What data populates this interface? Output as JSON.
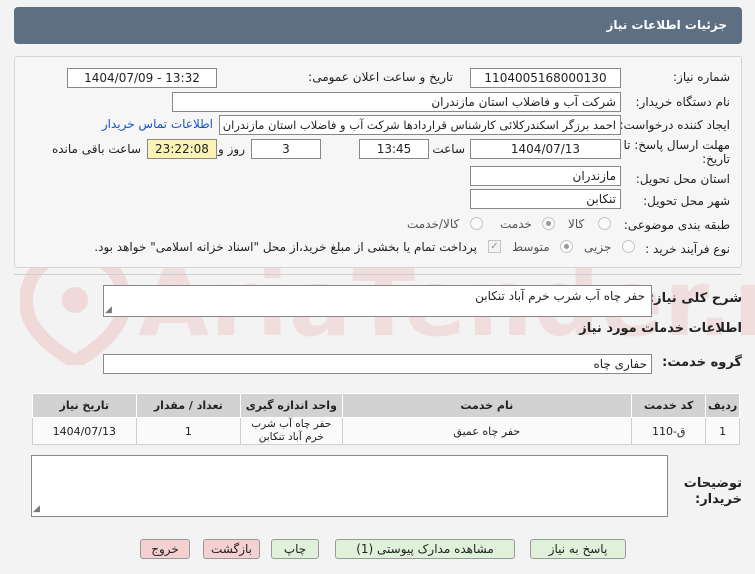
{
  "header": {
    "title": "جزئیات اطلاعات نیاز"
  },
  "fields": {
    "need_number_label": "شماره نیاز:",
    "need_number": "1104005168000130",
    "announce_label": "تاریخ و ساعت اعلان عمومی:",
    "announce_value": "1404/07/09 - 13:32",
    "buyer_org_label": "نام دستگاه خریدار:",
    "buyer_org": "شرکت آب و فاضلاب استان مازندران",
    "requester_label": "ایجاد کننده درخواست:",
    "requester": "احمد برزگر اسکندرکلائی کارشناس قراردادها شرکت آب و فاضلاب استان مازندران",
    "contact_link": "اطلاعات تماس خریدار",
    "deadline_label": "مهلت ارسال پاسخ: تا تاریخ:",
    "deadline_date": "1404/07/13",
    "time_label": "ساعت",
    "deadline_time": "13:45",
    "days_value": "3",
    "days_label": "روز و",
    "remaining_time": "23:22:08",
    "remaining_label": "ساعت باقی مانده",
    "province_label": "استان محل تحویل:",
    "province": "مازندران",
    "city_label": "شهر محل تحویل:",
    "city": "تنکابن",
    "category_label": "طبقه بندی موضوعی:",
    "category_options": [
      "کالا",
      "خدمت",
      "کالا/خدمت"
    ],
    "process_label": "نوع فرآیند خرید :",
    "process_options": [
      "جزیی",
      "متوسط"
    ],
    "payment_note": "پرداخت تمام یا بخشی از مبلغ خرید،از محل \"اسناد خزانه اسلامی\" خواهد بود."
  },
  "description": {
    "label": "شرح کلی نیاز:",
    "value": "حفر چاه آب شرب خرم آباد تنکابن"
  },
  "services": {
    "section_title": "اطلاعات خدمات مورد نیاز",
    "group_label": "گروه خدمت:",
    "group_value": "حفاری چاه",
    "columns": [
      "ردیف",
      "کد خدمت",
      "نام خدمت",
      "واحد اندازه گیری",
      "تعداد / مقدار",
      "تاریخ نیاز"
    ],
    "rows": [
      {
        "row": "1",
        "code": "ق-110",
        "name": "حفر چاه عمیق",
        "unit": "حفر چاه آب شرب خرم آباد تنکابن",
        "qty": "1",
        "date": "1404/07/13"
      }
    ]
  },
  "buyer_notes": {
    "label": "توضیحات خریدار:",
    "value": ""
  },
  "buttons": {
    "reply": "پاسخ به نیاز",
    "attachments": "مشاهده مدارک پیوستی (1)",
    "print": "چاپ",
    "back": "بازگشت",
    "exit": "خروج"
  },
  "watermark": "AriaTender.neT",
  "colors": {
    "header_bg": "#5d6f82",
    "remaining_bg": "#fbf3b5",
    "link": "#1a55c5"
  }
}
